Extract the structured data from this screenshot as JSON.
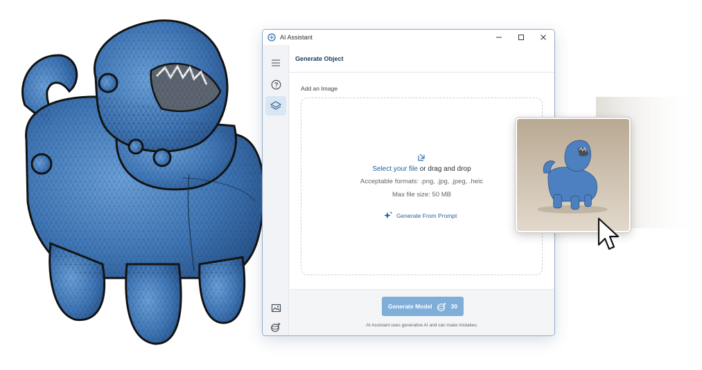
{
  "window": {
    "title": "AI Assistant",
    "controls": [
      "minimize-icon",
      "maximize-icon",
      "close-icon"
    ]
  },
  "sidebar": {
    "items": [
      {
        "name": "menu",
        "icon": "hamburger-icon",
        "active": false
      },
      {
        "name": "help",
        "icon": "help-circle-icon",
        "active": false
      },
      {
        "name": "layers",
        "icon": "layers-icon",
        "active": true
      }
    ],
    "bottom_items": [
      {
        "name": "gallery",
        "icon": "image-icon"
      },
      {
        "name": "generate",
        "icon": "sparkle-sphere-icon"
      }
    ]
  },
  "header": {
    "title": "Generate Object"
  },
  "upload": {
    "section_label": "Add an Image",
    "select_link": "Select your file",
    "drag_text": " or drag and drop",
    "formats": "Acceptable formats: .png, .jpg, .jpeg, .heic",
    "max_size": "Max file size: 50 MB",
    "generate_from_prompt": "Generate From Prompt"
  },
  "footer": {
    "button_label": "Generate Model",
    "credit_count": "30",
    "disclaimer": "AI Assistant uses generative AI and can make mistakes."
  },
  "colors": {
    "accent": "#1d5f9e",
    "button": "#7faed8",
    "header_text": "#1c3d63",
    "window_border": "#8eaac7",
    "object_blue": "#4f86c6"
  }
}
